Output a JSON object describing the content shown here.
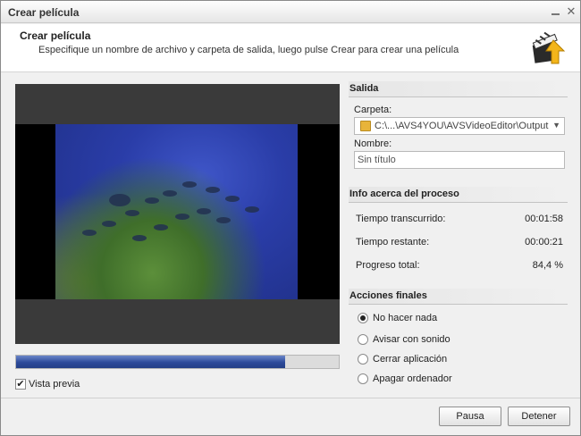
{
  "window": {
    "title": "Crear película"
  },
  "header": {
    "title": "Crear película",
    "subtitle": "Especifique un nombre de archivo y carpeta de salida, luego pulse Crear para crear una película",
    "logo_icon": "clapperboard-icon"
  },
  "preview": {
    "progress": 0.834,
    "checkbox_label": "Vista previa",
    "checkbox_checked": true
  },
  "salida": {
    "heading": "Salida",
    "folder_label": "Carpeta:",
    "folder_value": "C:\\...\\AVS4YOU\\AVSVideoEditor\\Output",
    "name_label": "Nombre:",
    "name_value": "Sin título"
  },
  "info": {
    "heading": "Info acerca del proceso",
    "rows": [
      {
        "label": "Tiempo transcurrido:",
        "value": "00:01:58"
      },
      {
        "label": "Tiempo restante:",
        "value": "00:00:21"
      },
      {
        "label": "Progreso total:",
        "value": "84,4 %"
      }
    ]
  },
  "acciones": {
    "heading": "Acciones finales",
    "options": [
      {
        "label": "No hacer nada",
        "selected": true
      },
      {
        "label": "Avisar con sonido",
        "selected": false
      },
      {
        "label": "Cerrar aplicación",
        "selected": false
      },
      {
        "label": "Apagar ordenador",
        "selected": false
      }
    ]
  },
  "buttons": {
    "pause": "Pausa",
    "stop": "Detener"
  },
  "colors": {
    "progress_fill": "#2d4a9a",
    "window_bg": "#f0f0f0"
  }
}
